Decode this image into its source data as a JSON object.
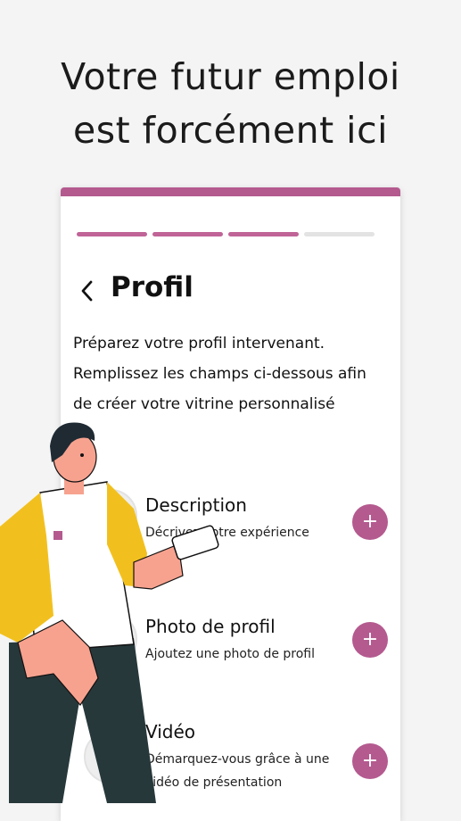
{
  "headline": {
    "line1": "Votre futur emploi",
    "line2": "est forcément ici"
  },
  "screen": {
    "title": "Profil",
    "intro": "Préparez votre profil intervenant. Remplissez les champs ci-dessous afin de créer votre vitrine personnalisé",
    "progress": {
      "total_steps": 4,
      "completed_steps": 3
    },
    "items": [
      {
        "label": "Description",
        "desc": "Décrivez votre expérience",
        "action": "+"
      },
      {
        "label": "Photo de profil",
        "desc": "Ajoutez une photo de profil",
        "action": "+"
      },
      {
        "label": "Vidéo",
        "desc": "Démarquez-vous grâce à une vidéo de présentation",
        "action": "+"
      }
    ]
  },
  "colors": {
    "accent": "#b45a8f",
    "progress_on": "#c06497",
    "progress_off": "#e3e3e3",
    "shirt_yellow": "#f2c01e",
    "pants": "#27383b"
  },
  "icons": {
    "back": "chevron-left-icon",
    "add": "plus-icon"
  }
}
